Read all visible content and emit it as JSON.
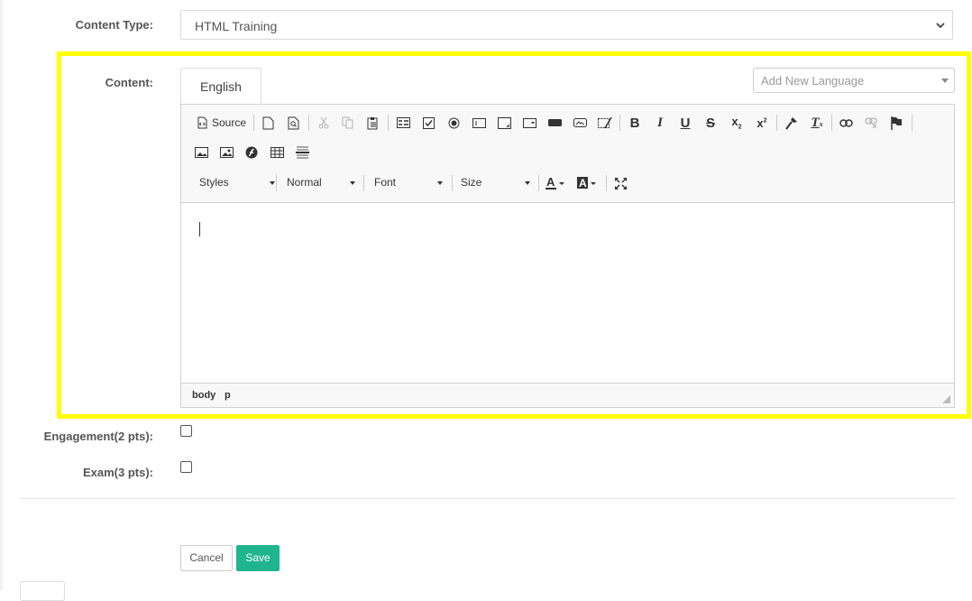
{
  "form": {
    "content_type_label": "Content Type:",
    "content_type_value": "HTML Training",
    "content_label": "Content:",
    "engagement_label": "Engagement(2 pts):",
    "exam_label": "Exam(3 pts):",
    "engagement_checked": false,
    "exam_checked": false
  },
  "editor": {
    "tab_label": "English",
    "add_language_placeholder": "Add New Language",
    "source_label": "Source",
    "styles_label": "Styles",
    "format_label": "Normal",
    "font_label": "Font",
    "size_label": "Size",
    "path": [
      "body",
      "p"
    ]
  },
  "actions": {
    "cancel_label": "Cancel",
    "save_label": "Save"
  },
  "colors": {
    "highlight": "#ffff00",
    "save_button": "#1fb58f"
  },
  "icons": [
    "source-icon",
    "new-page-icon",
    "preview-icon",
    "cut-icon",
    "copy-icon",
    "paste-icon",
    "form-icon",
    "checkbox-icon",
    "radio-icon",
    "text-field-icon",
    "textarea-icon",
    "select-icon",
    "button-icon",
    "image-button-icon",
    "hidden-field-icon",
    "bold-icon",
    "italic-icon",
    "underline-icon",
    "strike-icon",
    "subscript-icon",
    "superscript-icon",
    "copy-format-icon",
    "remove-format-icon",
    "link-icon",
    "unlink-icon",
    "anchor-icon",
    "image-icon",
    "image2-icon",
    "flash-icon",
    "table-icon",
    "horizontal-rule-icon",
    "text-color-icon",
    "bg-color-icon",
    "maximize-icon"
  ]
}
